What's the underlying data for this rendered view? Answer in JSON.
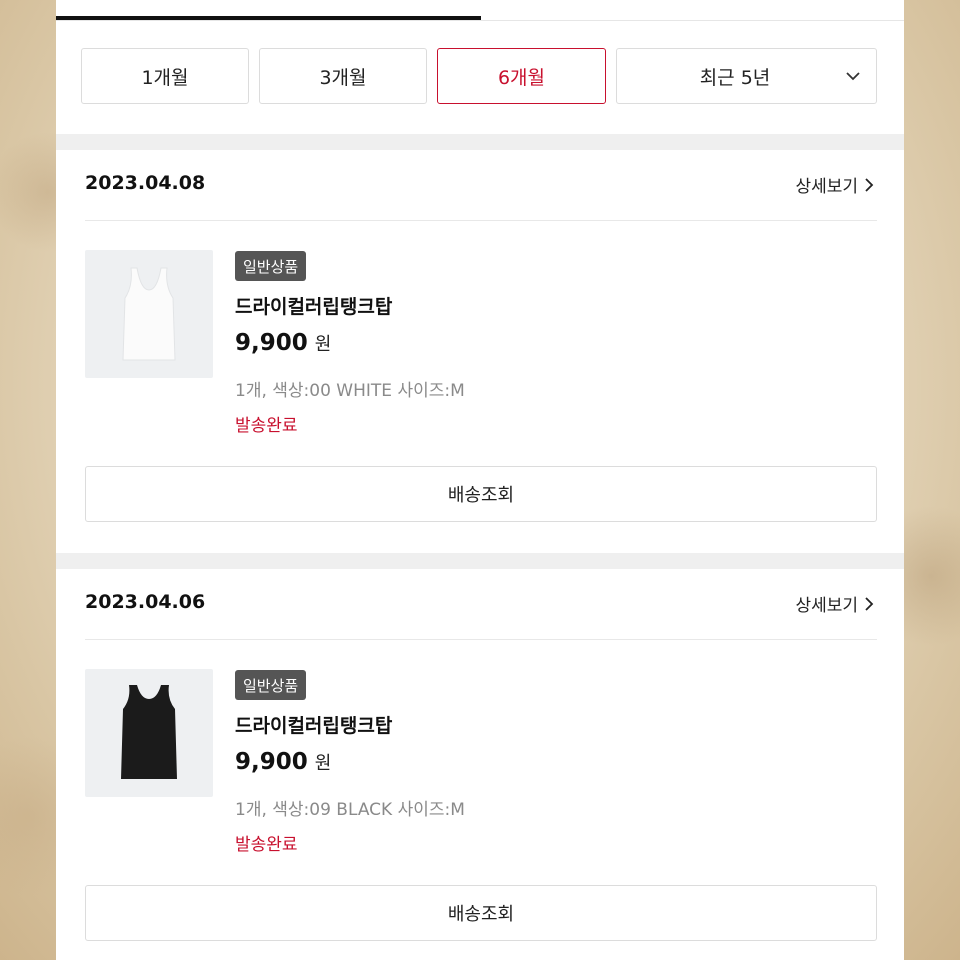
{
  "filters": {
    "one_month": "1개월",
    "three_months": "3개월",
    "six_months": "6개월",
    "period_select": "최근 5년",
    "accent_color": "#c8102e"
  },
  "orders": [
    {
      "date": "2023.04.08",
      "detail_label": "상세보기",
      "badge": "일반상품",
      "product_name": "드라이컬러립탱크탑",
      "price": "9,900",
      "currency": "원",
      "options": "1개, 색상:00 WHITE 사이즈:M",
      "status": "발송완료",
      "track_label": "배송조회",
      "image_icon": "white-tank-top-image"
    },
    {
      "date": "2023.04.06",
      "detail_label": "상세보기",
      "badge": "일반상품",
      "product_name": "드라이컬러립탱크탑",
      "price": "9,900",
      "currency": "원",
      "options": "1개, 색상:09 BLACK 사이즈:M",
      "status": "발송완료",
      "track_label": "배송조회",
      "image_icon": "black-tank-top-image"
    }
  ]
}
